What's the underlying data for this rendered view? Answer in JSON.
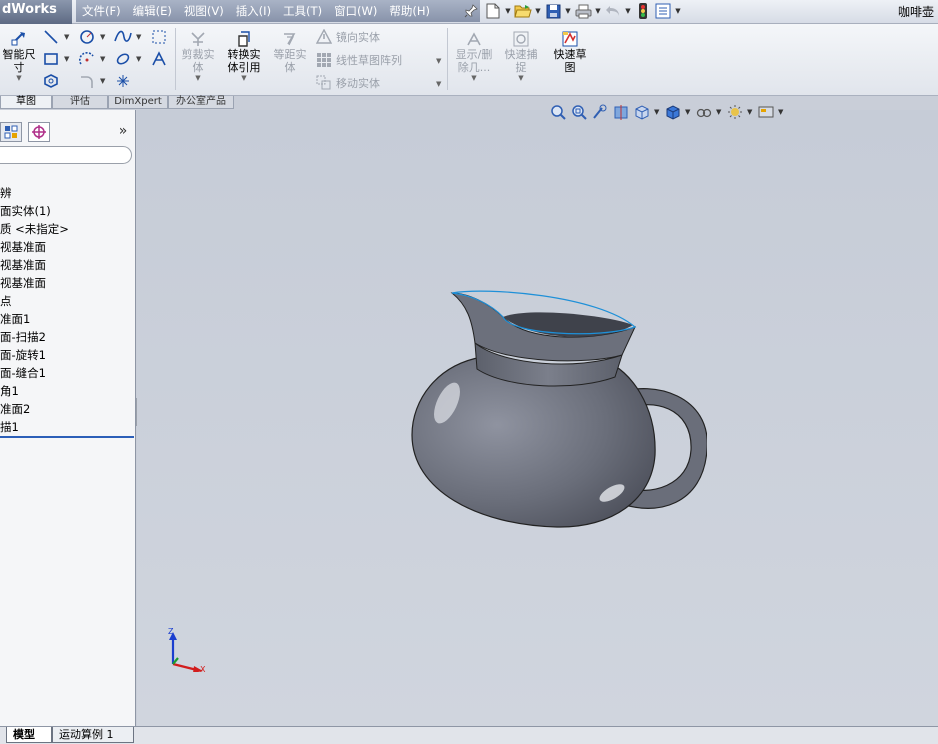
{
  "app": {
    "logo_text": "dWorks",
    "document_title": "咖啡壶"
  },
  "menu": [
    {
      "label": "文件(F)"
    },
    {
      "label": "编辑(E)"
    },
    {
      "label": "视图(V)"
    },
    {
      "label": "插入(I)"
    },
    {
      "label": "工具(T)"
    },
    {
      "label": "窗口(W)"
    },
    {
      "label": "帮助(H)"
    }
  ],
  "quick_tools": [
    "new-doc-icon",
    "open-folder-icon",
    "save-icon",
    "print-icon",
    "undo-icon",
    "traffic-light-icon",
    "options-icon"
  ],
  "command_manager": {
    "smart_dimension": "智能尺\n寸",
    "trim": "剪裁实\n体",
    "convert": "转换实\n体引用",
    "offset": "等距实\n体",
    "mirror": "镜向实体",
    "linear_pattern": "线性草图阵列",
    "move": "移动实体",
    "show_delete": "显示/删\n除几...",
    "quick_snap": "快速捕\n捉",
    "rapid_sketch": "快速草\n图"
  },
  "tabs": [
    {
      "label": "草图",
      "active": true
    },
    {
      "label": "评估",
      "active": false
    },
    {
      "label": "DimXpert",
      "active": false
    },
    {
      "label": "办公室产品",
      "active": false
    }
  ],
  "feature_tree": [
    {
      "label": "辨"
    },
    {
      "label": "面实体(1)"
    },
    {
      "label": "质 <未指定>"
    },
    {
      "label": "视基准面"
    },
    {
      "label": "视基准面"
    },
    {
      "label": "视基准面"
    },
    {
      "label": "点"
    },
    {
      "label": "准面1"
    },
    {
      "label": "面-扫描2"
    },
    {
      "label": "面-旋转1"
    },
    {
      "label": "面-缝合1"
    },
    {
      "label": "角1"
    },
    {
      "label": "准面2"
    },
    {
      "label": "描1"
    }
  ],
  "triad": {
    "z": "Z",
    "x": "X"
  },
  "bottom_tabs": [
    {
      "label": "模型",
      "active": true
    },
    {
      "label": "运动算例 1",
      "active": false
    }
  ],
  "colors": {
    "body": "#6a6e7a",
    "edge": "#1e90d8",
    "viewport": "#c9ced8"
  }
}
